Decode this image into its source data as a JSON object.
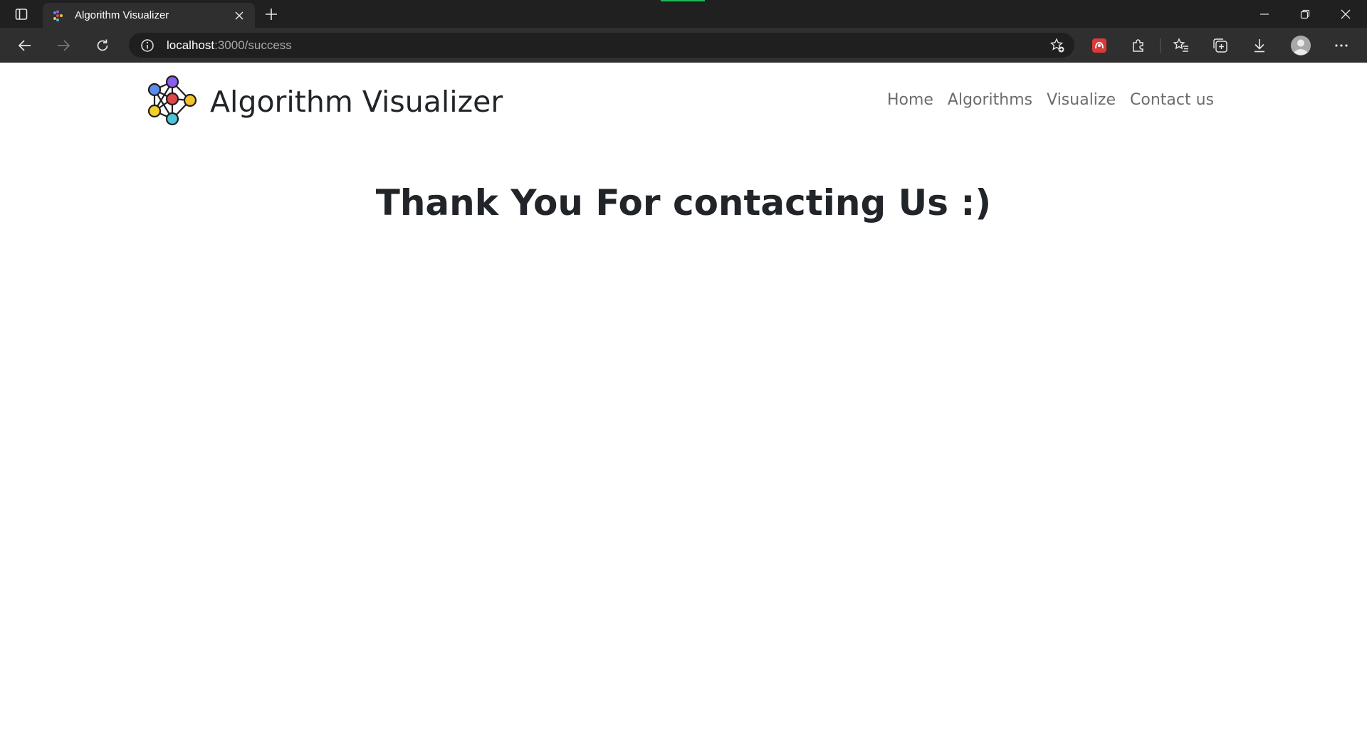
{
  "browser": {
    "tab": {
      "title": "Algorithm Visualizer"
    },
    "address_bar": {
      "host": "localhost",
      "path": ":3000/success"
    }
  },
  "site": {
    "brand_name": "Algorithm Visualizer",
    "nav": [
      "Home",
      "Algorithms",
      "Visualize",
      "Contact us"
    ]
  },
  "main": {
    "heading": "Thank You For contacting Us :)"
  },
  "colors": {
    "chrome_dark": "#202020",
    "toolbar": "#2f2f2f",
    "text_dark": "#212529",
    "nav_text": "#6c6c6c"
  }
}
